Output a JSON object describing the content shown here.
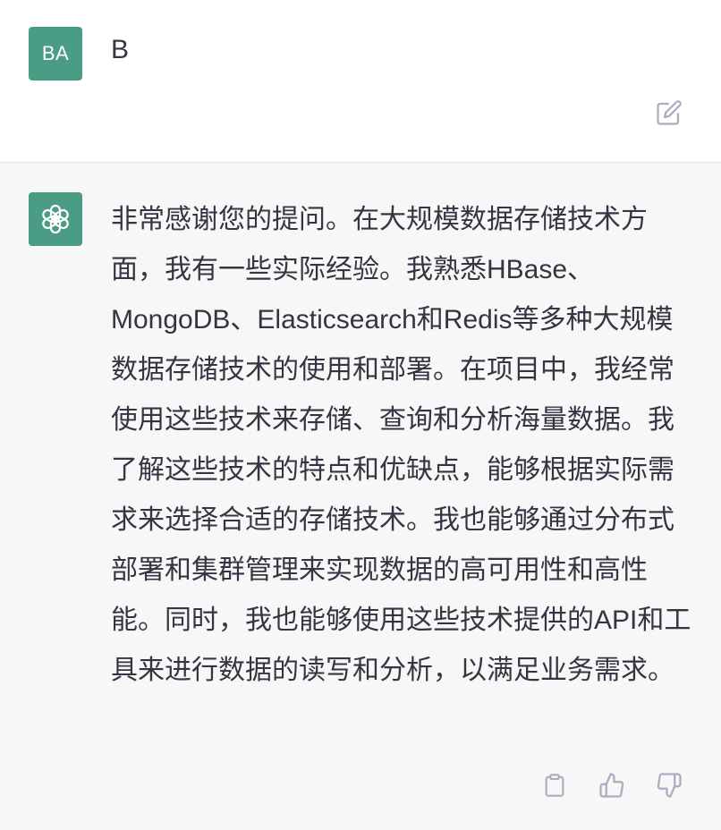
{
  "user_message": {
    "avatar_initials": "BA",
    "text": "B",
    "avatar_color": "#4b9c84"
  },
  "assistant_message": {
    "text": "非常感谢您的提问。在大规模数据存储技术方面，我有一些实际经验。我熟悉HBase、MongoDB、Elasticsearch和Redis等多种大规模数据存储技术的使用和部署。在项目中，我经常使用这些技术来存储、查询和分析海量数据。我了解这些技术的特点和优缺点，能够根据实际需求来选择合适的存储技术。我也能够通过分布式部署和集群管理来实现数据的高可用性和高性能。同时，我也能够使用这些技术提供的API和工具来进行数据的读写和分析，以满足业务需求。",
    "avatar_icon": "openai-logo-icon",
    "background_color": "#f7f7f8"
  },
  "actions": {
    "edit_icon": "edit-icon",
    "copy_icon": "clipboard-icon",
    "like_icon": "thumbs-up-icon",
    "dislike_icon": "thumbs-down-icon",
    "icon_color": "#acacbe"
  }
}
